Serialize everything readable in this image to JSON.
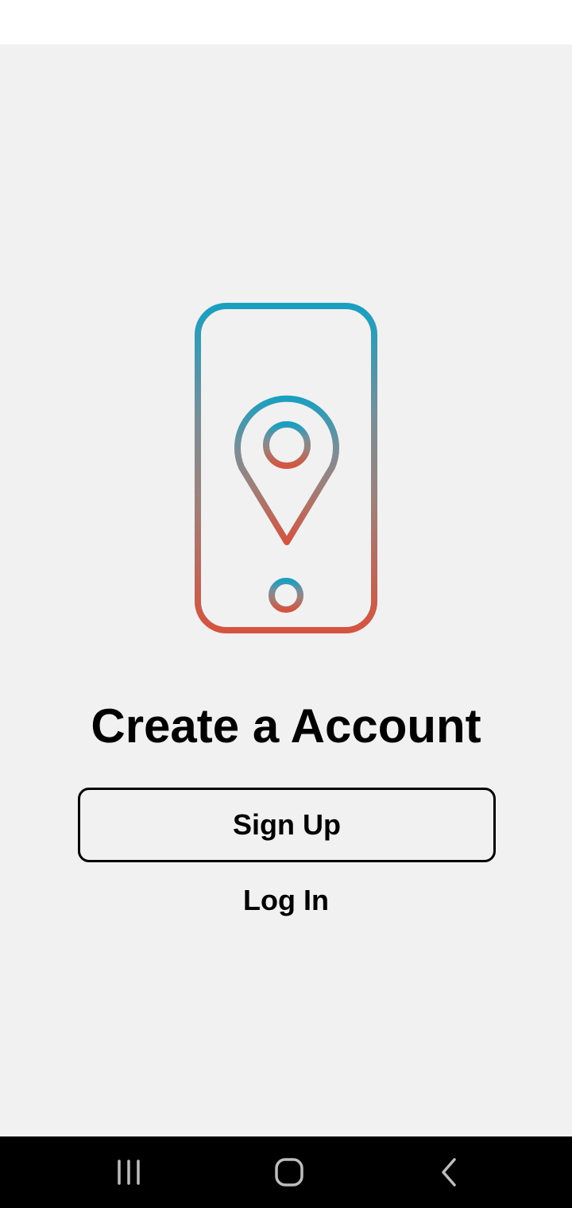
{
  "screen": {
    "title": "Create a Account",
    "signup_label": "Sign Up",
    "login_label": "Log In"
  },
  "illustration": {
    "icon": "phone-location-pin-icon",
    "gradient_top": "#1a9fc0",
    "gradient_bottom": "#d45440"
  },
  "nav": {
    "recents_icon": "recents-icon",
    "home_icon": "home-icon",
    "back_icon": "back-icon"
  }
}
